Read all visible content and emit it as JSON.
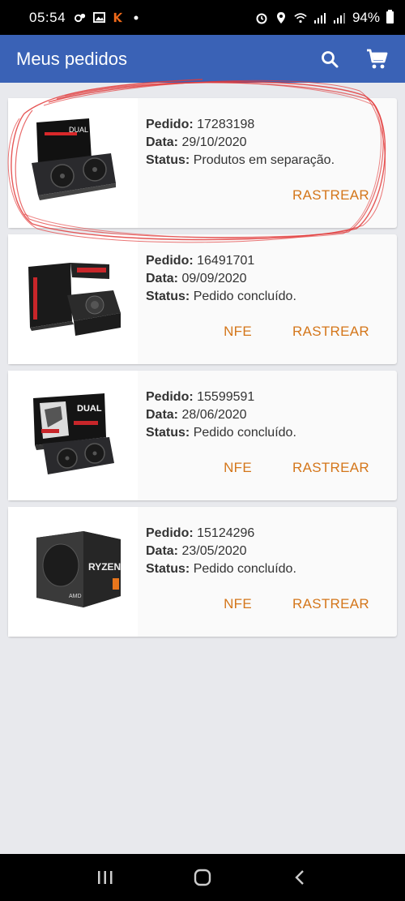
{
  "status_bar": {
    "time": "05:54",
    "battery": "94%"
  },
  "app_bar": {
    "title": "Meus pedidos",
    "search_icon": "search-icon",
    "cart_icon": "cart-icon"
  },
  "labels": {
    "pedido": "Pedido:",
    "data": "Data:",
    "status": "Status:"
  },
  "orders": [
    {
      "pedido": "17283198",
      "data": "29/10/2020",
      "status": "Produtos em separação.",
      "product_image": "graphics-card-dual",
      "nfe": "",
      "rastrear": "RASTREAR"
    },
    {
      "pedido": "16491701",
      "data": "09/09/2020",
      "status": "Pedido concluído.",
      "product_image": "power-supply",
      "nfe": "NFE",
      "rastrear": "RASTREAR"
    },
    {
      "pedido": "15599591",
      "data": "28/06/2020",
      "status": "Pedido concluído.",
      "product_image": "graphics-card-dual",
      "nfe": "NFE",
      "rastrear": "RASTREAR"
    },
    {
      "pedido": "15124296",
      "data": "23/05/2020",
      "status": "Pedido concluído.",
      "product_image": "ryzen-cpu-box",
      "nfe": "NFE",
      "rastrear": "RASTREAR"
    }
  ],
  "colors": {
    "app_bar": "#3a62b6",
    "action_text": "#d4761a",
    "highlight_scribble": "#e23a3a"
  }
}
